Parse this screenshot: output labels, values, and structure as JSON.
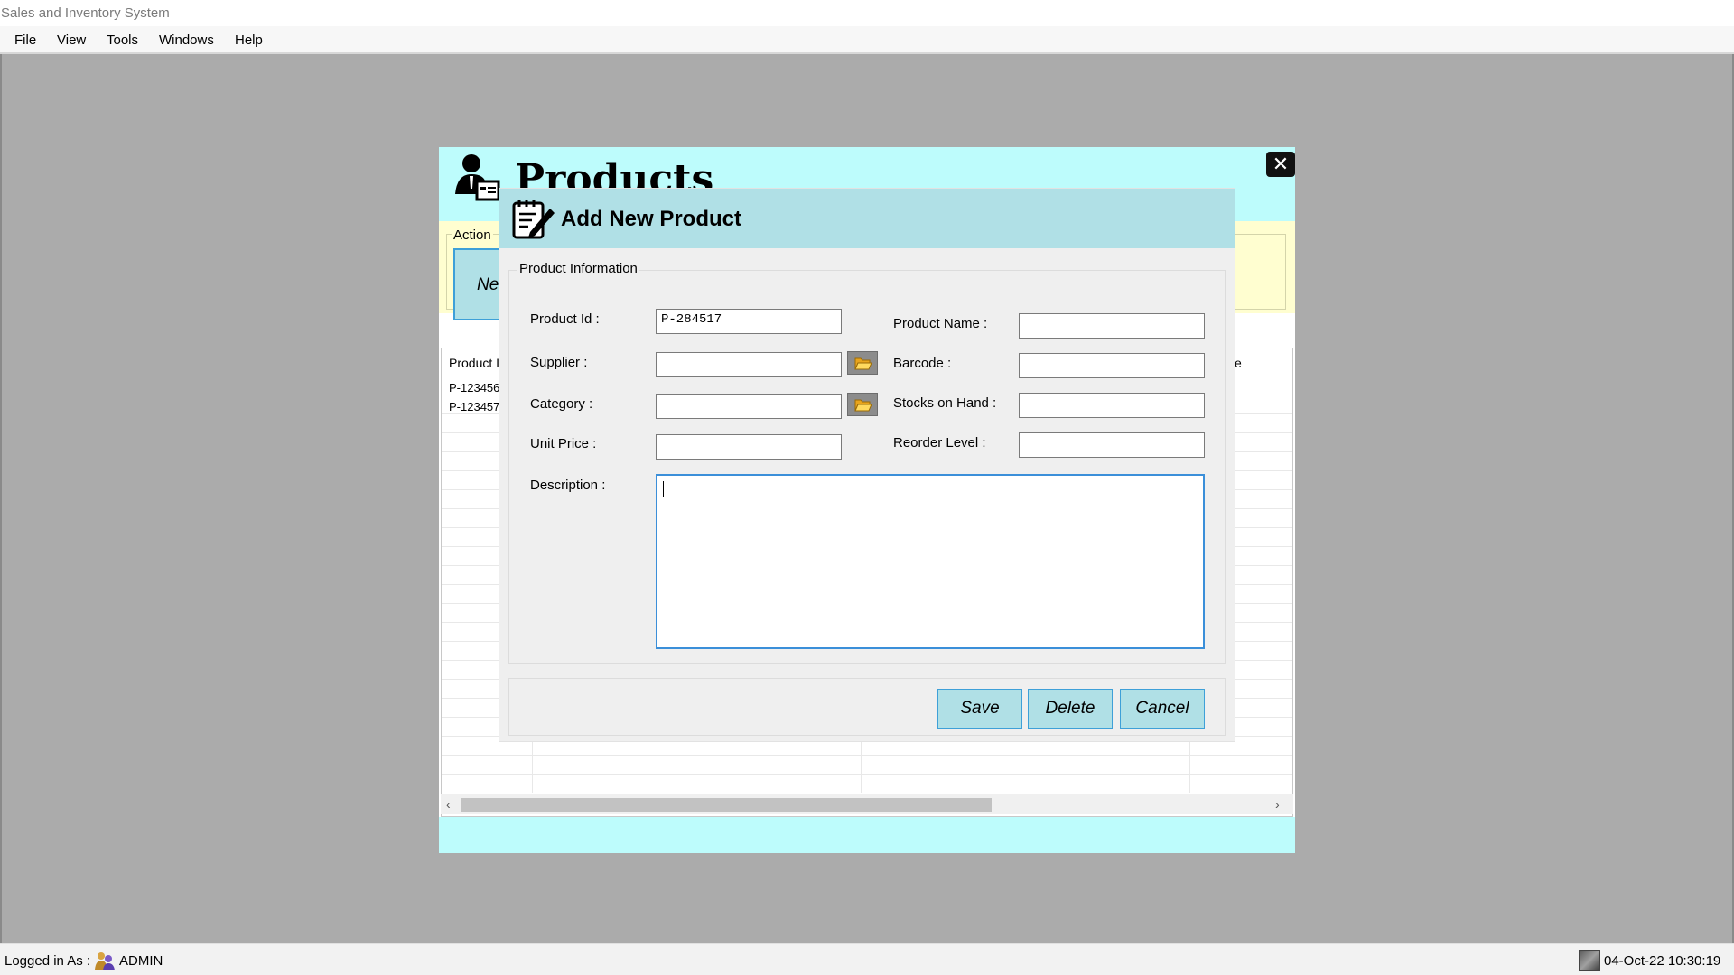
{
  "window": {
    "title": "Sales and Inventory System"
  },
  "menu": {
    "items": [
      "File",
      "View",
      "Tools",
      "Windows",
      "Help"
    ]
  },
  "products_window": {
    "title": "Products",
    "action_label": "Action",
    "new_button": "Ne",
    "grid_header_left": "Product I",
    "grid_header_right": "e",
    "rows": [
      "P-123456",
      "P-123457"
    ]
  },
  "dialog": {
    "title": "Add New Product",
    "group_label": "Product Information",
    "fields": {
      "product_id": {
        "label": "Product Id :",
        "value": "P-284517"
      },
      "supplier": {
        "label": "Supplier :",
        "value": ""
      },
      "category": {
        "label": "Category :",
        "value": ""
      },
      "unit_price": {
        "label": "Unit Price :",
        "value": ""
      },
      "description": {
        "label": "Description :",
        "value": ""
      },
      "product_name": {
        "label": "Product Name :",
        "value": ""
      },
      "barcode": {
        "label": "Barcode :",
        "value": ""
      },
      "stocks_on_hand": {
        "label": "Stocks on Hand :",
        "value": ""
      },
      "reorder_level": {
        "label": "Reorder Level :",
        "value": ""
      }
    },
    "buttons": {
      "save": "Save",
      "delete": "Delete",
      "cancel": "Cancel"
    }
  },
  "status": {
    "logged_in_label": "Logged in As :",
    "user": "ADMIN",
    "datetime": "04-Oct-22 10:30:19"
  },
  "icons": {
    "products": "user-card-icon",
    "dialog": "edit-note-icon",
    "browse": "folder-open-icon",
    "close": "close-icon",
    "user": "users-icon",
    "clock": "photo-thumbnail-icon"
  },
  "colors": {
    "workspace": "#ababab",
    "header_cyan": "#bdfcfc",
    "action_yellow": "#fffed0",
    "dialog_header": "#b0e0e6",
    "button_face": "#b0e0e6",
    "button_border": "#3ea0d8"
  }
}
